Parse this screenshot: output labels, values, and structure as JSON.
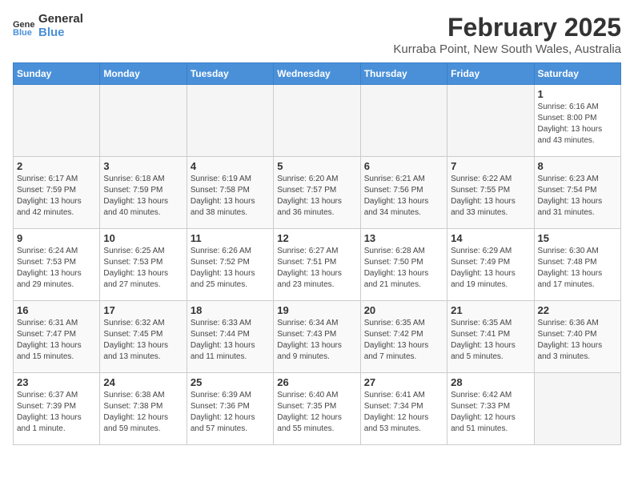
{
  "logo": {
    "text_general": "General",
    "text_blue": "Blue"
  },
  "title": "February 2025",
  "subtitle": "Kurraba Point, New South Wales, Australia",
  "weekdays": [
    "Sunday",
    "Monday",
    "Tuesday",
    "Wednesday",
    "Thursday",
    "Friday",
    "Saturday"
  ],
  "weeks": [
    [
      {
        "day": "",
        "info": ""
      },
      {
        "day": "",
        "info": ""
      },
      {
        "day": "",
        "info": ""
      },
      {
        "day": "",
        "info": ""
      },
      {
        "day": "",
        "info": ""
      },
      {
        "day": "",
        "info": ""
      },
      {
        "day": "1",
        "info": "Sunrise: 6:16 AM\nSunset: 8:00 PM\nDaylight: 13 hours and 43 minutes."
      }
    ],
    [
      {
        "day": "2",
        "info": "Sunrise: 6:17 AM\nSunset: 7:59 PM\nDaylight: 13 hours and 42 minutes."
      },
      {
        "day": "3",
        "info": "Sunrise: 6:18 AM\nSunset: 7:59 PM\nDaylight: 13 hours and 40 minutes."
      },
      {
        "day": "4",
        "info": "Sunrise: 6:19 AM\nSunset: 7:58 PM\nDaylight: 13 hours and 38 minutes."
      },
      {
        "day": "5",
        "info": "Sunrise: 6:20 AM\nSunset: 7:57 PM\nDaylight: 13 hours and 36 minutes."
      },
      {
        "day": "6",
        "info": "Sunrise: 6:21 AM\nSunset: 7:56 PM\nDaylight: 13 hours and 34 minutes."
      },
      {
        "day": "7",
        "info": "Sunrise: 6:22 AM\nSunset: 7:55 PM\nDaylight: 13 hours and 33 minutes."
      },
      {
        "day": "8",
        "info": "Sunrise: 6:23 AM\nSunset: 7:54 PM\nDaylight: 13 hours and 31 minutes."
      }
    ],
    [
      {
        "day": "9",
        "info": "Sunrise: 6:24 AM\nSunset: 7:53 PM\nDaylight: 13 hours and 29 minutes."
      },
      {
        "day": "10",
        "info": "Sunrise: 6:25 AM\nSunset: 7:53 PM\nDaylight: 13 hours and 27 minutes."
      },
      {
        "day": "11",
        "info": "Sunrise: 6:26 AM\nSunset: 7:52 PM\nDaylight: 13 hours and 25 minutes."
      },
      {
        "day": "12",
        "info": "Sunrise: 6:27 AM\nSunset: 7:51 PM\nDaylight: 13 hours and 23 minutes."
      },
      {
        "day": "13",
        "info": "Sunrise: 6:28 AM\nSunset: 7:50 PM\nDaylight: 13 hours and 21 minutes."
      },
      {
        "day": "14",
        "info": "Sunrise: 6:29 AM\nSunset: 7:49 PM\nDaylight: 13 hours and 19 minutes."
      },
      {
        "day": "15",
        "info": "Sunrise: 6:30 AM\nSunset: 7:48 PM\nDaylight: 13 hours and 17 minutes."
      }
    ],
    [
      {
        "day": "16",
        "info": "Sunrise: 6:31 AM\nSunset: 7:47 PM\nDaylight: 13 hours and 15 minutes."
      },
      {
        "day": "17",
        "info": "Sunrise: 6:32 AM\nSunset: 7:45 PM\nDaylight: 13 hours and 13 minutes."
      },
      {
        "day": "18",
        "info": "Sunrise: 6:33 AM\nSunset: 7:44 PM\nDaylight: 13 hours and 11 minutes."
      },
      {
        "day": "19",
        "info": "Sunrise: 6:34 AM\nSunset: 7:43 PM\nDaylight: 13 hours and 9 minutes."
      },
      {
        "day": "20",
        "info": "Sunrise: 6:35 AM\nSunset: 7:42 PM\nDaylight: 13 hours and 7 minutes."
      },
      {
        "day": "21",
        "info": "Sunrise: 6:35 AM\nSunset: 7:41 PM\nDaylight: 13 hours and 5 minutes."
      },
      {
        "day": "22",
        "info": "Sunrise: 6:36 AM\nSunset: 7:40 PM\nDaylight: 13 hours and 3 minutes."
      }
    ],
    [
      {
        "day": "23",
        "info": "Sunrise: 6:37 AM\nSunset: 7:39 PM\nDaylight: 13 hours and 1 minute."
      },
      {
        "day": "24",
        "info": "Sunrise: 6:38 AM\nSunset: 7:38 PM\nDaylight: 12 hours and 59 minutes."
      },
      {
        "day": "25",
        "info": "Sunrise: 6:39 AM\nSunset: 7:36 PM\nDaylight: 12 hours and 57 minutes."
      },
      {
        "day": "26",
        "info": "Sunrise: 6:40 AM\nSunset: 7:35 PM\nDaylight: 12 hours and 55 minutes."
      },
      {
        "day": "27",
        "info": "Sunrise: 6:41 AM\nSunset: 7:34 PM\nDaylight: 12 hours and 53 minutes."
      },
      {
        "day": "28",
        "info": "Sunrise: 6:42 AM\nSunset: 7:33 PM\nDaylight: 12 hours and 51 minutes."
      },
      {
        "day": "",
        "info": ""
      }
    ]
  ]
}
